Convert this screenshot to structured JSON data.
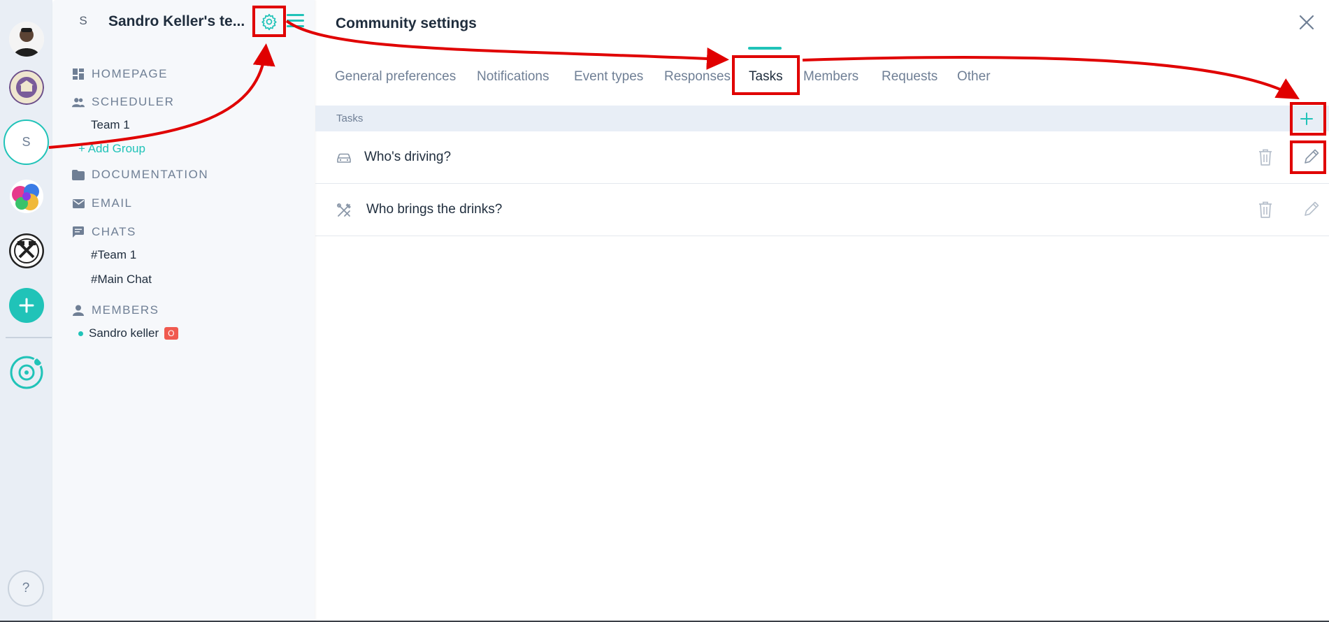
{
  "rail": {
    "team_initial": "S",
    "help_label": "?",
    "add_icon": "plus-icon"
  },
  "sidebar": {
    "team_initial": "S",
    "team_name": "Sandro Keller's te...",
    "sections": {
      "homepage": "HOMEPAGE",
      "scheduler": "SCHEDULER",
      "documentation": "DOCUMENTATION",
      "email": "EMAIL",
      "chats": "CHATS",
      "members": "MEMBERS"
    },
    "scheduler_items": [
      "Team 1"
    ],
    "add_group": "+ Add Group",
    "chat_items": [
      "#Team 1",
      "#Main Chat"
    ],
    "members": [
      {
        "name": "Sandro keller",
        "badge": "O"
      }
    ]
  },
  "main": {
    "title": "Community settings",
    "tabs": [
      "General preferences",
      "Notifications",
      "Event types",
      "Responses",
      "Tasks",
      "Members",
      "Requests",
      "Other"
    ],
    "active_tab": "Tasks",
    "tasks_header": "Tasks",
    "tasks": [
      {
        "name": "Who's driving?",
        "icon": "car-icon"
      },
      {
        "name": "Who brings the drinks?",
        "icon": "tools-icon"
      }
    ]
  },
  "colors": {
    "accent": "#20c3b8",
    "annotation": "#e00000",
    "badge": "#f05a4f"
  }
}
